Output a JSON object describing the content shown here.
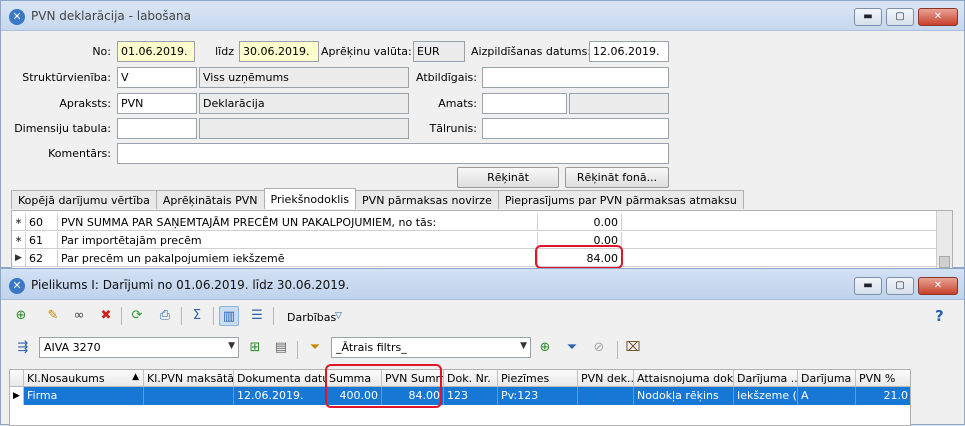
{
  "window1": {
    "title": "PVN deklarācija - labošana",
    "buttons": {
      "minimize": "▬",
      "maximize": "▢",
      "close": "✕"
    },
    "form": {
      "no_label": "No:",
      "no_value": "01.06.2019.",
      "lidz_label": "līdz",
      "lidz_value": "30.06.2019.",
      "currency_label": "Aprēķinu valūta:",
      "currency_value": "EUR",
      "filled_date_label": "Aizpildīšanas datums:",
      "filled_date_value": "12.06.2019.",
      "struct_label": "Struktūrvienība:",
      "struct_code": "V",
      "struct_name": "Viss uzņēmums",
      "responsible_label": "Atbildīgais:",
      "responsible_value": "",
      "desc_label": "Apraksts:",
      "desc_code": "PVN",
      "desc_name": "Deklarācija",
      "position_label": "Amats:",
      "position_value": "",
      "position_value2": "",
      "dim_label": "Dimensiju tabula:",
      "dim_code": "",
      "dim_name": "",
      "phone_label": "Tālrunis:",
      "phone_value": "",
      "comment_label": "Komentārs:",
      "comment_value": "",
      "calc_btn": "Rēķināt",
      "calc_bg_btn": "Rēķināt fonā..."
    },
    "tabs": [
      "Kopējā darījumu vērtība",
      "Aprēķinātais PVN",
      "Priekšnodoklis",
      "PVN pārmaksas novirze",
      "Pieprasījums par PVN pārmaksas atmaksu"
    ],
    "rows": [
      {
        "ind": "∗",
        "code": "60",
        "desc": "PVN SUMMA PAR SAŅEMTAJĀM PRECĒM UN PAKALPOJUMIEM, no tās:",
        "amount": "0.00"
      },
      {
        "ind": "∗",
        "code": "61",
        "desc": "Par importētajām precēm",
        "amount": "0.00"
      },
      {
        "ind": "▶",
        "code": "62",
        "desc": "Par precēm un pakalpojumiem iekšzemē",
        "amount": "84.00"
      }
    ]
  },
  "window2": {
    "title": "Pielikums I: Darījumi no 01.06.2019. līdz 30.06.2019.",
    "buttons": {
      "minimize": "▬",
      "maximize": "▢",
      "close": "✕"
    },
    "actions_label": "Darbības",
    "help": "?",
    "company_value": "AIVA 3270",
    "filter_value": "_Ātrais filtrs_",
    "columns": [
      "Kl.Nosaukums",
      "Kl.PVN maksātā...",
      "Dokumenta datu...",
      "Summa",
      "PVN Summa",
      "Dok. Nr.",
      "Piezīmes",
      "PVN dek...",
      "Attaisnojuma dok...",
      "Darījuma ...",
      "Darījuma ...",
      "PVN %"
    ],
    "row": [
      "Firma",
      "",
      "12.06.2019.",
      "400.00",
      "84.00",
      "123",
      "Pv:123",
      "",
      "Nodokļa rēķins",
      "Iekšzeme (I)",
      "A",
      "21.0"
    ]
  },
  "colors": {
    "accent": "#1777d4",
    "highlight": "#e0142a",
    "yellow_field": "#fdfccc"
  }
}
